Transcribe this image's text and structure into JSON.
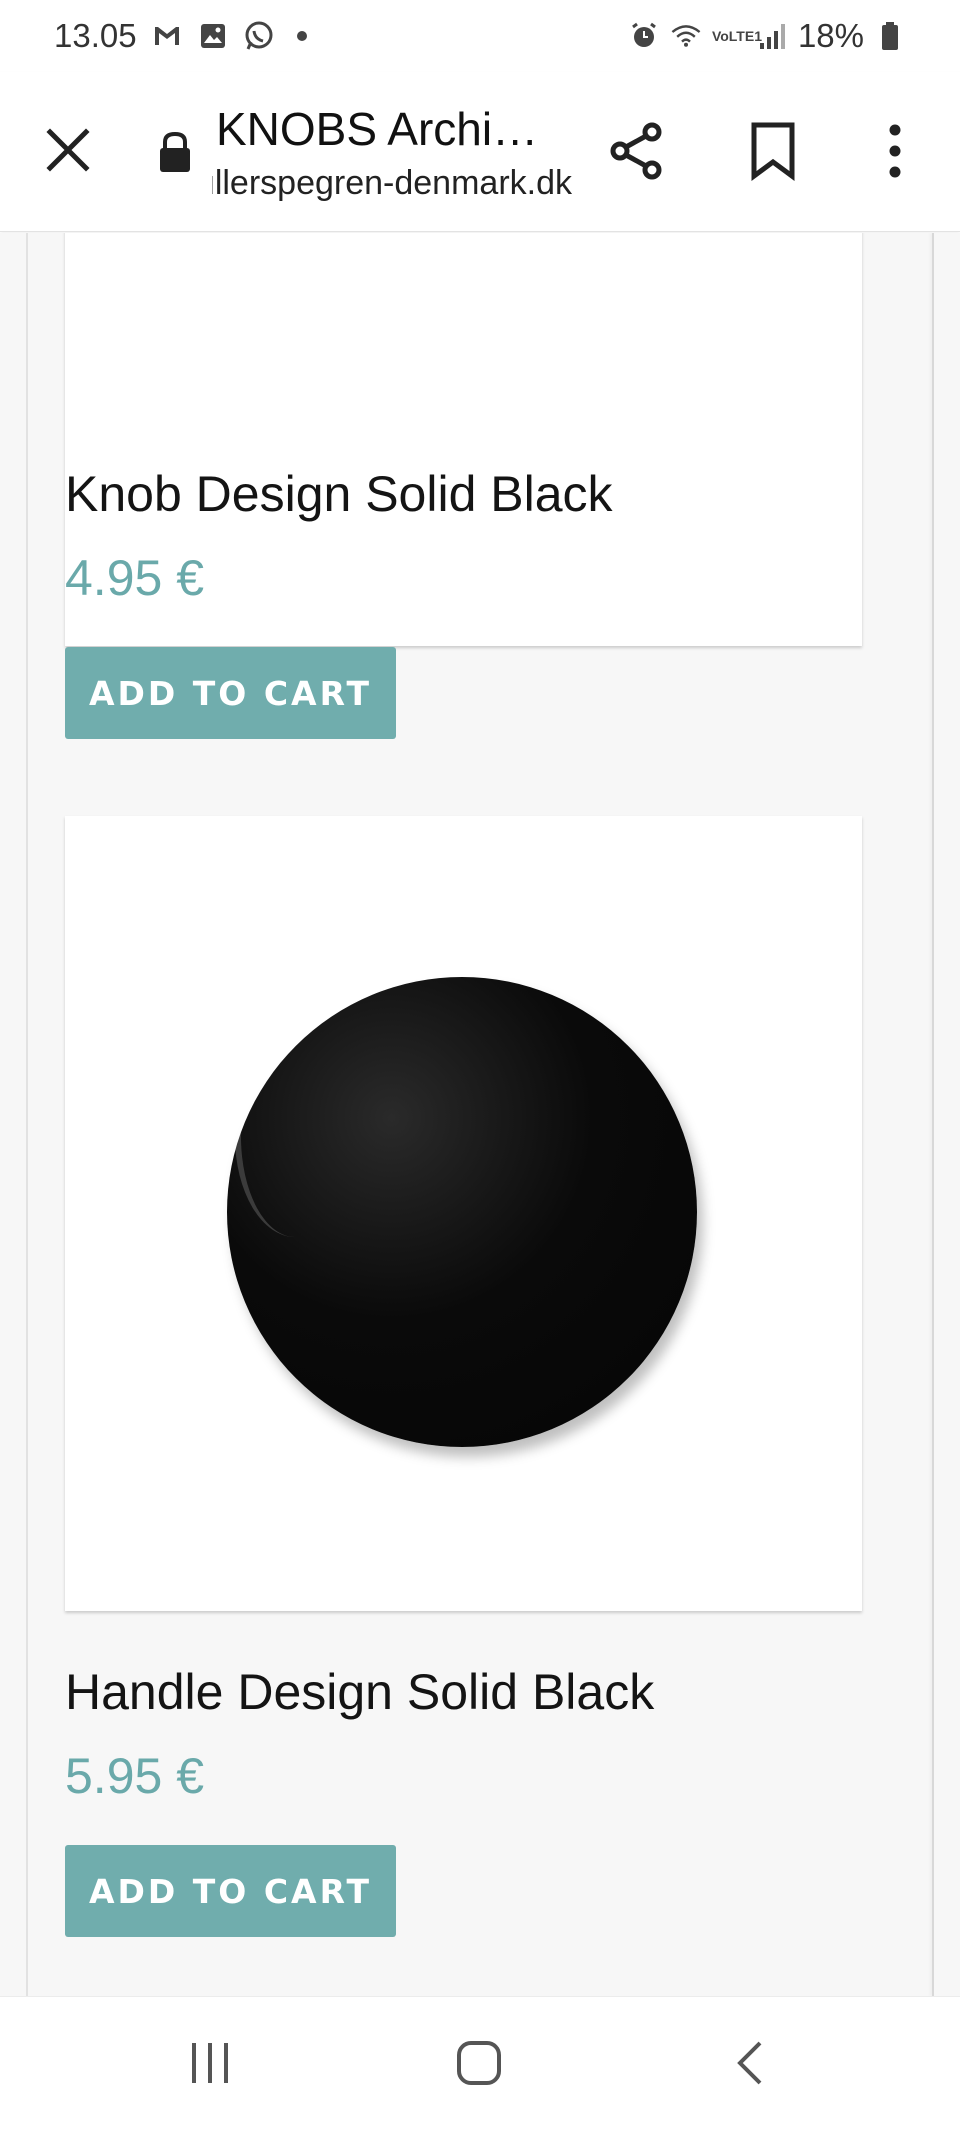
{
  "status_bar": {
    "time": "13.05",
    "battery": "18%",
    "network": "VoLTE1",
    "left_icons": [
      "gmail-icon",
      "gallery-icon",
      "whatsapp-icon"
    ],
    "right_icons": [
      "alarm-icon",
      "wifi-icon",
      "signal-icon",
      "battery-icon"
    ]
  },
  "toolbar": {
    "title": "KNOBS Archi…",
    "url": "mullerspegren-denmark.dk",
    "icons": [
      "close-icon",
      "lock-icon",
      "share-icon",
      "bookmark-icon",
      "more-icon"
    ]
  },
  "products": [
    {
      "name": "Knob Design Solid Black",
      "price": "4.95 €",
      "button_label": "ADD TO CART"
    },
    {
      "name": "Handle Design Solid Black",
      "price": "5.95 €",
      "button_label": "ADD TO CART"
    }
  ],
  "colors": {
    "accent": "#70adad",
    "price": "#6aa9aa",
    "page_bg": "#f7f7f7"
  },
  "nav_bar": {
    "icons": [
      "recents-icon",
      "home-icon",
      "back-icon"
    ]
  }
}
